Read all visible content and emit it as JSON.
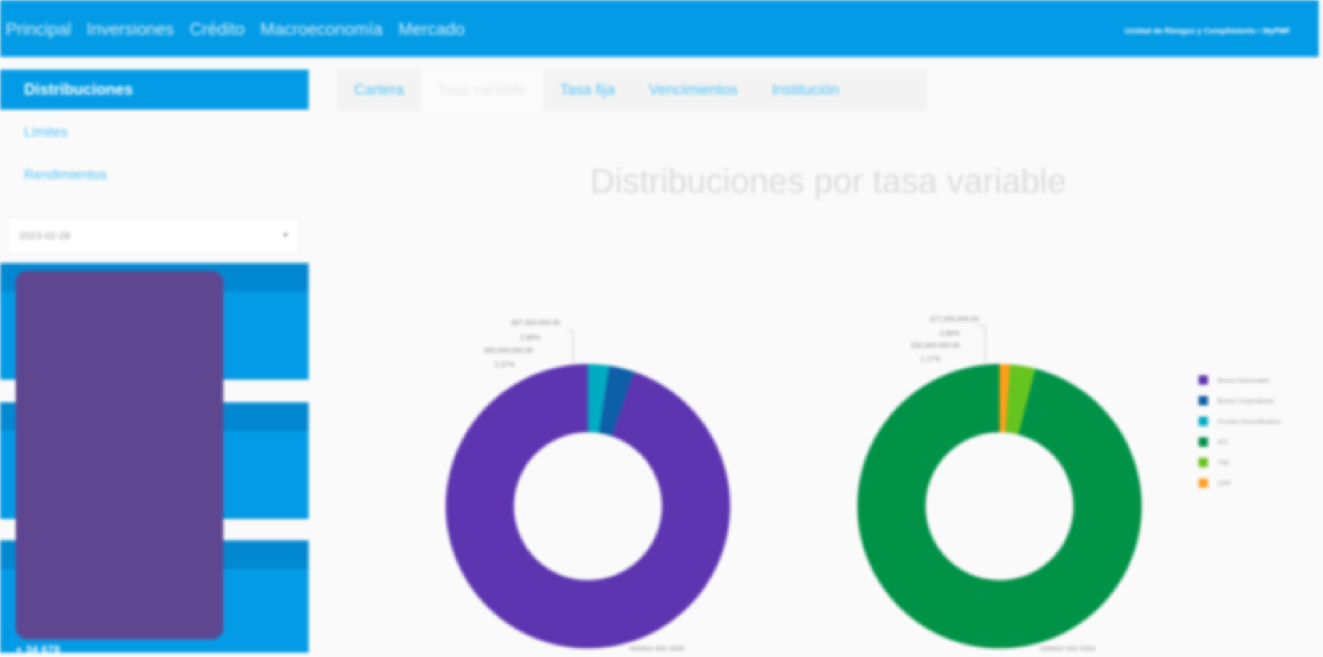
{
  "topnav": {
    "items": [
      "Principal",
      "Inversiones",
      "Crédito",
      "Macroeconomía",
      "Mercado"
    ],
    "right_label": "Unidad de Riesgos y Cumplimiento • MyPMF"
  },
  "sidebar": {
    "active_item": "Distribuciones",
    "items": [
      "Límites",
      "Rendimientos"
    ],
    "date_value": "2023-02-28",
    "card_footer": "+ 34 678"
  },
  "tabs": [
    "Cartera",
    "Tasa variable",
    "Tasa fija",
    "Vencimientos",
    "Institución"
  ],
  "page_title": "Distribuciones por tasa variable",
  "charts": {
    "left": {
      "callouts": [
        {
          "amount": "367,000,000.00",
          "pct": "2.88%"
        },
        {
          "amount": "300,000,000.00",
          "pct": "2.37%"
        }
      ],
      "footer_label": "xxxxxx xxx xxxx"
    },
    "right": {
      "callouts": [
        {
          "amount": "377,000,000.00",
          "pct": "2.88%"
        },
        {
          "amount": "150,000,000.00",
          "pct": "1.17%"
        }
      ],
      "footer_label": "xxxxxx xxx xxxx"
    }
  },
  "legend": [
    {
      "label": "Bonos Nacionales",
      "color": "#5e35b1"
    },
    {
      "label": "Bonos Corporativos",
      "color": "#0d5fa8"
    },
    {
      "label": "Fondos Diversificados",
      "color": "#00acc1"
    },
    {
      "label": "IPC",
      "color": "#009246"
    },
    {
      "label": "TIIE",
      "color": "#66c41e"
    },
    {
      "label": "CPP",
      "color": "#ff9f1a"
    }
  ],
  "chart_data": [
    {
      "type": "pie",
      "title": "",
      "categories": [
        "Bonos Nacionales",
        "Bonos Corporativos",
        "Fondos Diversificados"
      ],
      "values": [
        94.75,
        2.88,
        2.37
      ],
      "colors": [
        "#5e35b1",
        "#0d5fa8",
        "#00acc1"
      ]
    },
    {
      "type": "pie",
      "title": "",
      "categories": [
        "IPC",
        "TIIE",
        "CPP"
      ],
      "values": [
        95.95,
        2.88,
        1.17
      ],
      "colors": [
        "#009246",
        "#66c41e",
        "#ff9f1a"
      ]
    }
  ]
}
